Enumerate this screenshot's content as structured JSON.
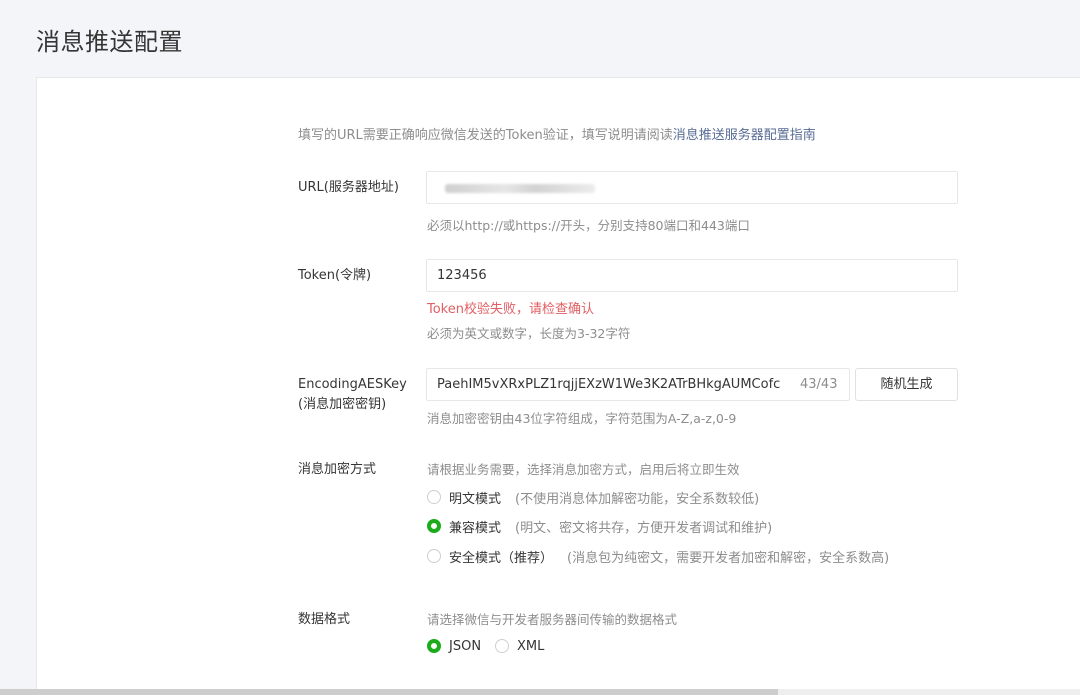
{
  "page": {
    "title": "消息推送配置"
  },
  "intro": {
    "text": "填写的URL需要正确响应微信发送的Token验证，填写说明请阅读",
    "link": "消息推送服务器配置指南"
  },
  "url_field": {
    "label": "URL(服务器地址)",
    "value": "",
    "help": "必须以http://或https://开头，分别支持80端口和443端口"
  },
  "token_field": {
    "label": "Token(令牌)",
    "value": "123456",
    "error": "Token校验失败，请检查确认",
    "help": "必须为英文或数字，长度为3-32字符"
  },
  "aes_field": {
    "label_line1": "EncodingAESKey",
    "label_line2": "(消息加密密钥)",
    "value": "PaehIM5vXRxPLZ1rqjjEXzW1We3K2ATrBHkgAUMCofc",
    "counter": "43/43",
    "generate_button": "随机生成",
    "help": "消息加密密钥由43位字符组成，字符范围为A-Z,a-z,0-9"
  },
  "encryption": {
    "label": "消息加密方式",
    "help": "请根据业务需要，选择消息加密方式，启用后将立即生效",
    "options": [
      {
        "label": "明文模式",
        "desc": "(不使用消息体加解密功能，安全系数较低)",
        "checked": false
      },
      {
        "label": "兼容模式",
        "desc": "(明文、密文将共存，方便开发者调试和维护)",
        "checked": true
      },
      {
        "label": "安全模式（推荐）",
        "desc": "(消息包为纯密文，需要开发者加密和解密，安全系数高)",
        "checked": false
      }
    ]
  },
  "data_format": {
    "label": "数据格式",
    "help": "请选择微信与开发者服务器间传输的数据格式",
    "options": [
      {
        "label": "JSON",
        "checked": true
      },
      {
        "label": "XML",
        "checked": false
      }
    ]
  },
  "colors": {
    "accent_green": "#1aad19",
    "error_red": "#e15f63",
    "link_blue": "#576b95"
  }
}
